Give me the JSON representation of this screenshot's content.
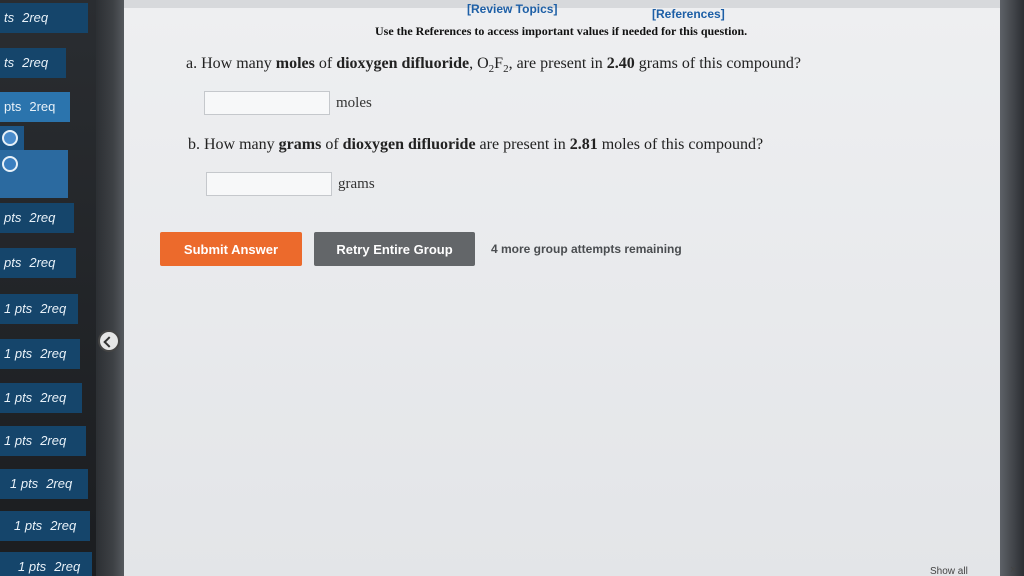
{
  "header": {
    "review_topics": "[Review Topics]",
    "references": "[References]",
    "instruction": "Use the References to access important values if needed for this question."
  },
  "sidebar": {
    "items": [
      {
        "pts": "ts",
        "req": "2req"
      },
      {
        "pts": "ts",
        "req": "2req"
      },
      {
        "pts": "pts",
        "req": "2req"
      },
      {
        "pts": "pts",
        "req": "2req"
      },
      {
        "pts": "pts",
        "req": "2req"
      },
      {
        "pts": "1 pts",
        "req": "2req"
      },
      {
        "pts": "1 pts",
        "req": "2req"
      },
      {
        "pts": "1 pts",
        "req": "2req"
      },
      {
        "pts": "1 pts",
        "req": "2req"
      },
      {
        "pts": "1 pts",
        "req": "2req"
      },
      {
        "pts": "1 pts",
        "req": "2req"
      },
      {
        "pts": "1 pts",
        "req": "2req"
      }
    ]
  },
  "question_a": {
    "part": "a.",
    "text_1": "How many",
    "bold_1": "moles",
    "text_2": "of",
    "bold_2": "dioxygen difluoride",
    "formula_o": "O",
    "formula_o_sub": "2",
    "formula_f": "F",
    "formula_f_sub": "2",
    "text_3": ", are present in",
    "bold_3": "2.40",
    "text_4": "grams of this compound?",
    "input_value": "",
    "unit": "moles"
  },
  "question_b": {
    "part": "b.",
    "text_1": "How many",
    "bold_1": "grams",
    "text_2": "of",
    "bold_2": "dioxygen difluoride",
    "text_3": "are present in",
    "bold_3": "2.81",
    "text_4": "moles of this compound?",
    "input_value": "",
    "unit": "grams"
  },
  "actions": {
    "submit_label": "Submit Answer",
    "retry_label": "Retry Entire Group",
    "attempts_text": "4 more group attempts remaining"
  },
  "footer": {
    "show_all": "Show all",
    "close": "×"
  },
  "colors": {
    "submit": "#ec6a2c",
    "retry": "#636669",
    "sidebar": "#15456b",
    "sidebar_active": "#2b74ad",
    "link": "#1d5fa6"
  }
}
